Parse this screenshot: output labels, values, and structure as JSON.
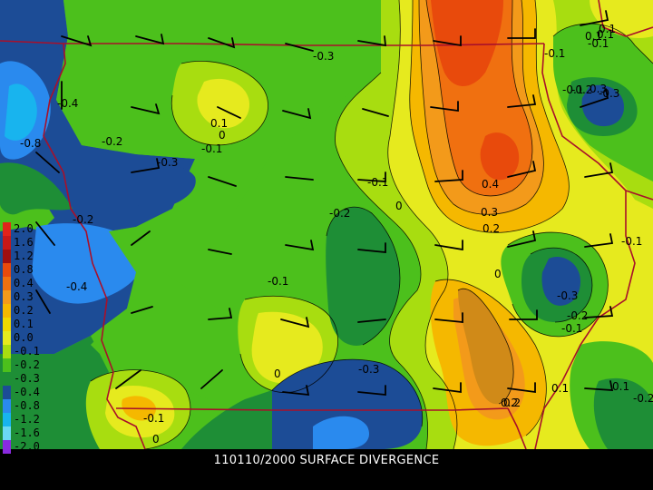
{
  "caption": "110110/2000 SURFACE DIVERGENCE",
  "legend": [
    {
      "label": "2.0",
      "color": "#e2231a"
    },
    {
      "label": "1.6",
      "color": "#c81818"
    },
    {
      "label": "1.2",
      "color": "#a00f0f"
    },
    {
      "label": "0.8",
      "color": "#e84a0c"
    },
    {
      "label": "0.4",
      "color": "#f07010"
    },
    {
      "label": "0.3",
      "color": "#f39a1a"
    },
    {
      "label": "0.2",
      "color": "#f5b800"
    },
    {
      "label": "0.1",
      "color": "#f0d800"
    },
    {
      "label": "0.0",
      "color": "#e6ea1e"
    },
    {
      "label": "-0.1",
      "color": "#a8dd10"
    },
    {
      "label": "-0.2",
      "color": "#4cc01c"
    },
    {
      "label": "-0.3",
      "color": "#1e8e36"
    },
    {
      "label": "-0.4",
      "color": "#1c4c96"
    },
    {
      "label": "-0.8",
      "color": "#2a8aee"
    },
    {
      "label": "-1.2",
      "color": "#18b4ee"
    },
    {
      "label": "-1.6",
      "color": "#6ad8f4"
    },
    {
      "label": "-2.0",
      "color": "#8a2ae0"
    }
  ],
  "contour_labels": [
    "-0.3",
    "-0.1",
    "-0.1",
    "-0.2",
    "-0.3",
    "0.1",
    "0.3",
    "-0.4",
    "0.1",
    "0",
    "-0.1",
    "-0.8",
    "-0.2",
    "-0.3",
    "-0.1",
    "0",
    "0.4",
    "-0.2",
    "0.3",
    "0.2",
    "-0.2",
    "-0.1",
    "0",
    "0.1",
    "-0.4",
    "-0.1",
    "-0.3",
    "-0.2",
    "-0.1",
    "0",
    "-0.3",
    "0.2",
    "0.1",
    "-0.1",
    "-0.2",
    "-0.1",
    "0",
    "0.2",
    "0.1",
    "0.1"
  ]
}
